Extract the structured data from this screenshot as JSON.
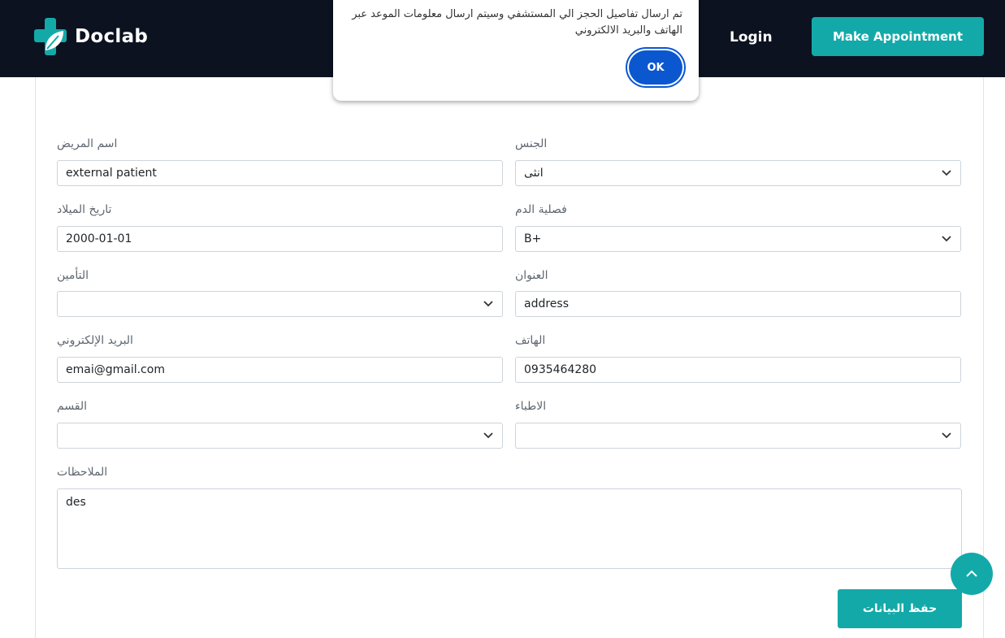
{
  "header": {
    "logo_text": "Doclab",
    "login": "Login",
    "make_appointment": "Make Appointment"
  },
  "dialog": {
    "message": "تم ارسال تفاصيل الحجز الي المستشفي وسيتم ارسال معلومات الموعد عبر الهاتف والبريد الالكتروني",
    "ok": "OK"
  },
  "form": {
    "gender": {
      "label": "الجنس",
      "value": "انثى"
    },
    "patient_name": {
      "label": "اسم المريض",
      "value": "external patient"
    },
    "blood_type": {
      "label": "فصلية الدم",
      "value": "B+"
    },
    "birth_date": {
      "label": "تاريخ الميلاد",
      "value": "2000-01-01"
    },
    "address": {
      "label": "العنوان",
      "value": "address"
    },
    "insurance": {
      "label": "التأمين",
      "value": ""
    },
    "phone": {
      "label": "الهاتف",
      "value": "0935464280"
    },
    "email": {
      "label": "البريد الإلكتروني",
      "value": "emai@gmail.com"
    },
    "doctors": {
      "label": "الاطباء",
      "value": ""
    },
    "department": {
      "label": "القسم",
      "value": ""
    },
    "notes": {
      "label": "الملاحظات",
      "value": "des"
    },
    "save": "حفظ البيانات"
  },
  "colors": {
    "accent": "#14a9a9",
    "header_bg": "#0c1220",
    "ok_button": "#0b57d0"
  }
}
